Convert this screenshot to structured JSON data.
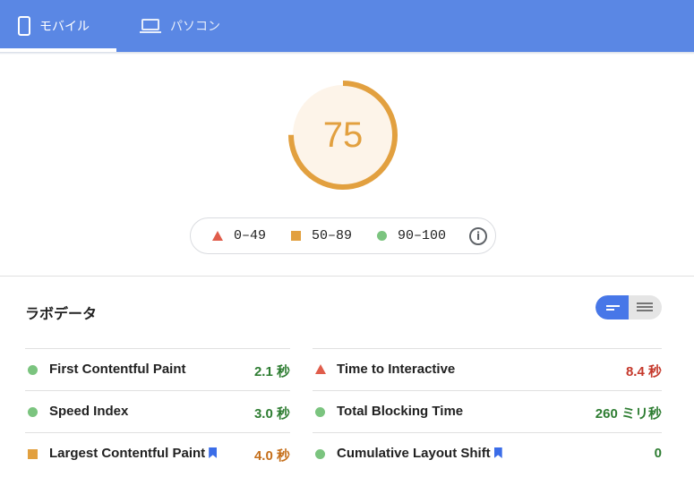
{
  "tabs": {
    "mobile_label": "モバイル",
    "desktop_label": "パソコン",
    "active": "mobile"
  },
  "score": {
    "value": "75",
    "fraction": 0.75,
    "color": "#e2a03f",
    "ring_bg": "#fdf4e9"
  },
  "legend": {
    "items": [
      {
        "range": "0–49",
        "shape": "triangle",
        "color": "#e05d4b"
      },
      {
        "range": "50–89",
        "shape": "square",
        "color": "#e2a03f"
      },
      {
        "range": "90–100",
        "shape": "circle",
        "color": "#7bc47f"
      }
    ],
    "info_icon": "info-icon"
  },
  "lab": {
    "title": "ラボデータ",
    "view_toggle": {
      "selected": "summary-view"
    },
    "left_metrics": [
      {
        "name": "First Contentful Paint",
        "value": "2.1 秒",
        "status": "pass",
        "bookmark": false
      },
      {
        "name": "Speed Index",
        "value": "3.0 秒",
        "status": "pass",
        "bookmark": false
      },
      {
        "name": "Largest Contentful Paint",
        "value": "4.0 秒",
        "status": "average",
        "bookmark": true
      }
    ],
    "right_metrics": [
      {
        "name": "Time to Interactive",
        "value": "8.4 秒",
        "status": "fail",
        "bookmark": false
      },
      {
        "name": "Total Blocking Time",
        "value": "260 ミリ秒",
        "status": "pass",
        "bookmark": false
      },
      {
        "name": "Cumulative Layout Shift",
        "value": "0",
        "status": "pass",
        "bookmark": true
      }
    ]
  },
  "colors": {
    "header": "#5a87e4",
    "pass": "#7bc47f",
    "average": "#e2a03f",
    "fail": "#e05d4b",
    "toggle_active": "#4777e8"
  }
}
